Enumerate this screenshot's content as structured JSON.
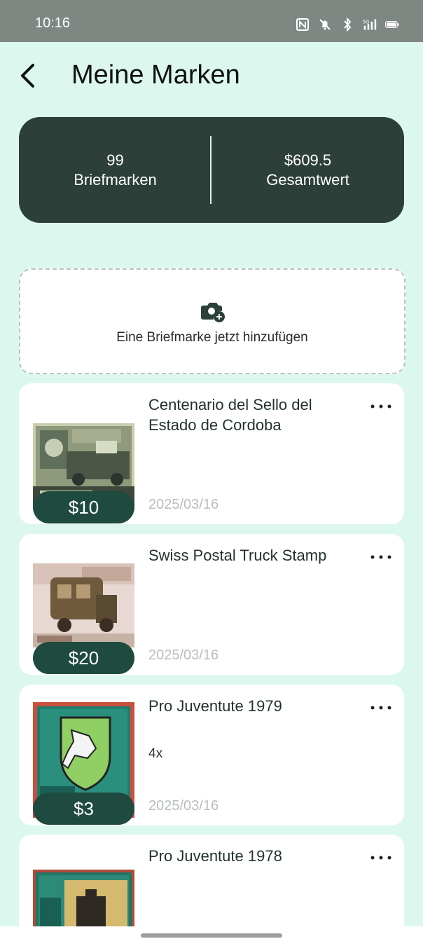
{
  "status_bar": {
    "time": "10:16",
    "icons": [
      "nfc-icon",
      "mute-bell-icon",
      "bluetooth-icon",
      "signal-5g-icon",
      "battery-icon"
    ]
  },
  "header": {
    "title": "Meine Marken",
    "back_icon": "chevron-left-icon"
  },
  "summary": {
    "count_value": "99",
    "count_label": "Briefmarken",
    "total_value": "$609.5",
    "total_label": "Gesamtwert"
  },
  "add_stamp": {
    "label": "Eine Briefmarke jetzt hinzufügen",
    "icon": "camera-add-icon"
  },
  "stamps": [
    {
      "title": "Centenario del Sello del Estado de Cordoba",
      "quantity": "",
      "price": "$10",
      "date": "2025/03/16"
    },
    {
      "title": "Swiss Postal Truck Stamp",
      "quantity": "",
      "price": "$20",
      "date": "2025/03/16"
    },
    {
      "title": "Pro Juventute 1979",
      "quantity": "4x",
      "price": "$3",
      "date": "2025/03/16"
    },
    {
      "title": "Pro Juventute 1978",
      "quantity": "",
      "price": "",
      "date": ""
    }
  ],
  "colors": {
    "background": "#dcf8ee",
    "summary_card": "#2c3f39",
    "price_pill": "#1f4a3f",
    "status_bar": "#7f8783"
  }
}
